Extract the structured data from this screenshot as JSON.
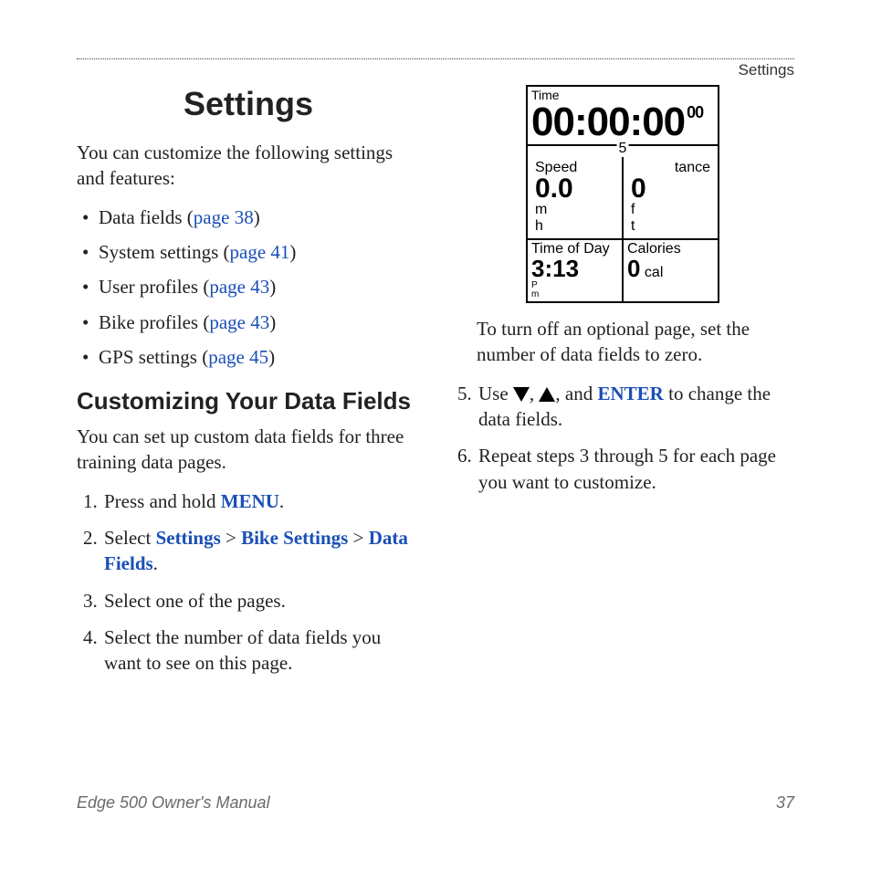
{
  "running_header": "Settings",
  "title": "Settings",
  "intro": "You can customize the following settings and features:",
  "bullets": [
    {
      "label": "Data fields",
      "pg": "page 38"
    },
    {
      "label": "System settings",
      "pg": "page 41"
    },
    {
      "label": "User profiles",
      "pg": "page 43"
    },
    {
      "label": "Bike profiles",
      "pg": "page 43"
    },
    {
      "label": "GPS settings",
      "pg": "page 45"
    }
  ],
  "subheading": "Customizing Your Data Fields",
  "subintro": "You can set up custom data fields for three training data pages.",
  "steps_left": {
    "s1_pre": "Press and hold ",
    "s1_kw": "MENU",
    "s1_post": ".",
    "s2_pre": "Select ",
    "s2_a": "Settings",
    "s2_sep": " > ",
    "s2_b": "Bike Settings",
    "s2_c": "Data Fields",
    "s2_post": ".",
    "s3": "Select one of the pages.",
    "s4": "Select the number of data fields you want to see on this page."
  },
  "device": {
    "time_label": "Time",
    "time_value": "00:00:00",
    "time_sub": "00",
    "spinner_value": "5",
    "speed_label": "Speed",
    "speed_value": "0.0",
    "speed_unit_top": "m",
    "speed_unit_bot": "h",
    "distance_label": "tance",
    "distance_value": "0",
    "distance_unit_top": "f",
    "distance_unit_bot": "t",
    "tod_label": "Time of Day",
    "tod_value": "3:13",
    "tod_unit_top": "P",
    "tod_unit_bot": "m",
    "cal_label": "Calories",
    "cal_value": "0",
    "cal_unit": "cal"
  },
  "caption_right": "To turn off an optional page, set the number of data fields to zero.",
  "steps_right": {
    "s5_pre": "Use ",
    "s5_mid": ", ",
    "s5_mid2": ", and ",
    "s5_kw": "ENTER",
    "s5_post": " to change the data fields.",
    "s6": "Repeat steps 3 through 5 for each page you want to customize."
  },
  "footer_left": "Edge 500 Owner's Manual",
  "footer_right": "37"
}
